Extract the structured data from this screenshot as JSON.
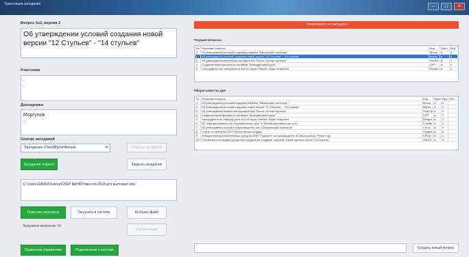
{
  "window": {
    "title": "Трансляция заседания",
    "controls": [
      "–",
      "□",
      "×"
    ]
  },
  "left": {
    "question_header": "Вопрос №2, версия 2",
    "question_text": "Об утверждении условий создания новой версии \"12 Стульев\" - \"14 стульев\"",
    "participants_label": "Участники",
    "participants_lines": "-\n-",
    "speakers_label": "Докладчики",
    "speakers_lines": "Моргунов\n-",
    "meetings_label": "Список заседаний",
    "meeting_selected": "Заседание СоюзМультФильм",
    "btn_open_meeting": "Открыть заседание",
    "btn_meeting_open_state": "Заседание открыто",
    "btn_close_meeting": "Закрыть заседание",
    "file_path": "C:\\Users\\GAVR\\Desktop\\СБЕР БАНК\\Повестка 2018 для выставки .xlsx",
    "btn_agenda_loaded": "Повестка загружена",
    "btn_load_to_system": "Загрузить в систему",
    "btn_choose_file": "Выбрать файл",
    "loaded_status": "Загружено вопросов: 10",
    "btn_presentation": "Презентация",
    "btn_board": "Правление управления",
    "btn_board_system": "Подключение к системе"
  },
  "right": {
    "voting_banner": "Голосование не запущено",
    "current_title": "Текущие вопросы",
    "current_table": {
      "columns": [
        "№",
        "Описание вопроса",
        "Код",
        "Прио",
        "Вер"
      ],
      "rows": [
        [
          "1",
          "Об утверждении условий создания ремейка \"Кавказский пленница\"",
          "Мосф",
          "а",
          "2"
        ],
        [
          "2",
          "Об утверждении условий создания новой версии \"12 Стульев\" - \"14 стульев\"",
          "Мульт",
          "а",
          "2"
        ],
        [
          "3",
          "Об утверждении изменения сценария к/ф \"Белое солнце пустыни\"",
          "ЛенФи",
          "а",
          "2"
        ],
        [
          "4",
          "Создание мультфильма по мотивам \"Крокодиловый рупа\"",
          "ЛУР",
          "а",
          "2"
        ],
        [
          "5",
          "Утверждение на главную роль в 8 ой серии \"Ремба\" Юрия Никулина",
          "Ленфи",
          "а",
          "2"
        ]
      ],
      "selected_row": 2
    },
    "common_title": "Общая повестка дня",
    "common_table": {
      "columns": [
        "№",
        "Описание вопроса",
        "Код",
        "Прио",
        "Вер",
        "Объ"
      ],
      "rows": [
        [
          "1",
          "Об утверждении условий создания ремейка \"Кавказский пленница\"",
          "Мосф",
          "а",
          "2",
          ""
        ],
        [
          "2",
          "Об утверждении условий создания новой версии \"12 Стульев\" - \"14 стульев\"",
          "Мульт",
          "а",
          "2",
          ""
        ],
        [
          "3",
          "Об утверждении изменения сценария к/ф \"Белое солнце пустыни\"",
          "ЛенСтр",
          "а",
          "2",
          ""
        ],
        [
          "4",
          "Создание мультфильма по мотивам \"Крокодиловый рупа\"",
          "ЛУР",
          "а",
          "2",
          ""
        ],
        [
          "5",
          "Утверждение на главную роль в 8 ой серии \"Ремба\" Юрия Никулина",
          "Ленфи",
          "а",
          "2",
          ""
        ],
        [
          "6",
          "Об переименовании х/ф \"Карнавальная ночь\" в \"Белая карнавальная ночь\"",
          "Главбу",
          "а",
          "2",
          ""
        ],
        [
          "7",
          "Об утверждении планов на производство х/ф \"Обалчающий лишенной\"",
          "Сб.Кр",
          "а",
          "2",
          ""
        ],
        [
          "8",
          "Статус и стратегия ООО \"Мотор фильм студия\"",
          "Студия",
          "а",
          "2",
          ""
        ],
        [
          "9",
          "О выделении дополнительных средств ООО \"Горизонт\" на производство 39-ой серии к/ф \"Робин Гуд\"",
          "Сб.Кр",
          "а",
          "1",
          ""
        ],
        [
          "10",
          "О возможности выдачи кредитных средств на создание сериала \"Атака куриных лапок\" (113 серий)",
          "ЛиСтр",
          "а",
          "1",
          ""
        ]
      ]
    },
    "new_question_input": "",
    "btn_create_question": "Создать новый вопрос"
  }
}
